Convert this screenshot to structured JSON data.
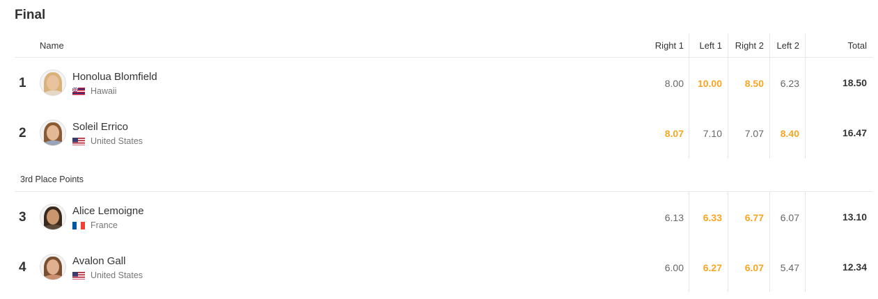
{
  "heat": {
    "title": "Final",
    "columns": {
      "name": "Name",
      "r1": "Right 1",
      "l1": "Left 1",
      "r2": "Right 2",
      "l2": "Left 2",
      "total": "Total"
    },
    "section_label": "3rd Place Points",
    "rows": [
      {
        "rank": "1",
        "name": "Honolua Blomfield",
        "country": "Hawaii",
        "flag": "hawaii-flag-icon",
        "scores": [
          "8.00",
          "10.00",
          "8.50",
          "6.23"
        ],
        "highlight": [
          false,
          true,
          true,
          false
        ],
        "total": "18.50"
      },
      {
        "rank": "2",
        "name": "Soleil Errico",
        "country": "United States",
        "flag": "us-flag-icon",
        "scores": [
          "8.07",
          "7.10",
          "7.07",
          "8.40"
        ],
        "highlight": [
          true,
          false,
          false,
          true
        ],
        "total": "16.47"
      },
      {
        "rank": "3",
        "name": "Alice Lemoigne",
        "country": "France",
        "flag": "france-flag-icon",
        "scores": [
          "6.13",
          "6.33",
          "6.77",
          "6.07"
        ],
        "highlight": [
          false,
          true,
          true,
          false
        ],
        "total": "13.10"
      },
      {
        "rank": "4",
        "name": "Avalon Gall",
        "country": "United States",
        "flag": "us-flag-icon",
        "scores": [
          "6.00",
          "6.27",
          "6.07",
          "5.47"
        ],
        "highlight": [
          false,
          true,
          true,
          false
        ],
        "total": "12.34"
      }
    ]
  },
  "colors": {
    "highlight": "#f5a623",
    "text": "#333333",
    "muted": "#777777",
    "divider": "#e8e8e8"
  }
}
